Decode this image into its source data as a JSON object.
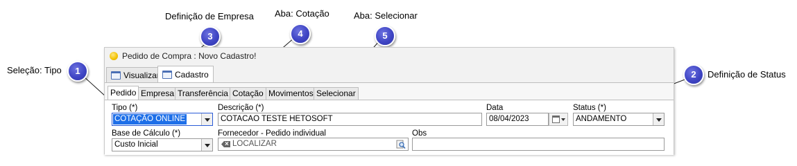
{
  "callouts": [
    {
      "number": "1",
      "text": "Seleção: Tipo"
    },
    {
      "number": "2",
      "text": "Definição de Status"
    },
    {
      "number": "3",
      "text": "Definição de Empresa"
    },
    {
      "number": "4",
      "text": "Aba: Cotação"
    },
    {
      "number": "5",
      "text": "Aba: Selecionar"
    }
  ],
  "window": {
    "title": "Pedido de Compra  : Novo Cadastro!",
    "title_icon": "yellow-circle-icon"
  },
  "top_tabs": [
    {
      "label": "Visualizar",
      "icon": "window-icon",
      "active": false
    },
    {
      "label": "Cadastro",
      "icon": "window-icon",
      "active": true
    }
  ],
  "sub_tabs": [
    {
      "label": "Pedido",
      "active": true
    },
    {
      "label": "Empresa",
      "active": false
    },
    {
      "label": "Transferência",
      "active": false
    },
    {
      "label": "Cotação",
      "active": false
    },
    {
      "label": "Movimentos",
      "active": false
    },
    {
      "label": "Selecionar",
      "active": false
    }
  ],
  "form": {
    "tipo": {
      "label": "Tipo (*)",
      "value": "COTAÇÃO ONLINE"
    },
    "descricao": {
      "label": "Descrição (*)",
      "value": "COTACAO TESTE HETOSOFT"
    },
    "data": {
      "label": "Data",
      "value": "08/04/2023"
    },
    "status": {
      "label": "Status (*)",
      "value": "ANDAMENTO"
    },
    "base_calculo": {
      "label": "Base de Cálculo (*)",
      "value": "Custo Inicial"
    },
    "fornecedor": {
      "label": "Fornecedor - Pedido individual",
      "placeholder": "LOCALIZAR"
    },
    "obs": {
      "label": "Obs",
      "value": ""
    }
  },
  "colors": {
    "marker": "#3f45c4",
    "selection": "#1e6fe8"
  }
}
